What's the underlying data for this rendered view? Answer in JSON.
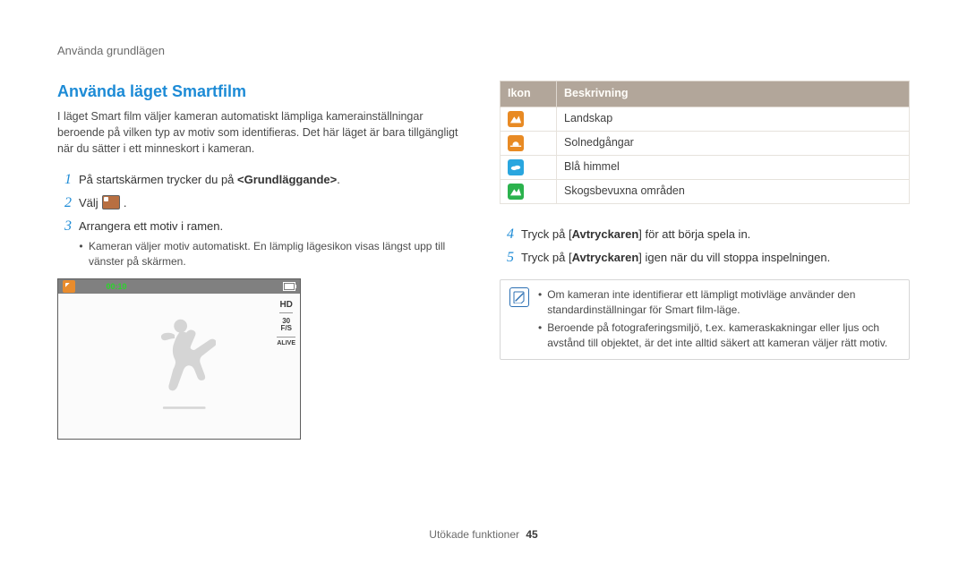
{
  "breadcrumb": "Använda grundlägen",
  "section_title": "Använda läget Smartfilm",
  "intro": "I läget Smart film väljer kameran automatiskt lämpliga kamerainställningar beroende på vilken typ av motiv som identifieras. Det här läget är bara tillgängligt när du sätter i ett minneskort i kameran.",
  "steps_left": [
    {
      "num": "1",
      "pre": "På startskärmen trycker du på ",
      "bold": "<Grundläggande>",
      "post": ".",
      "sub": null
    },
    {
      "num": "2",
      "pre": "Välj ",
      "bold": null,
      "post": ".",
      "icon": "smart-mode-icon",
      "sub": null
    },
    {
      "num": "3",
      "pre": "Arrangera ett motiv i ramen.",
      "bold": null,
      "post": "",
      "sub": [
        "Kameran väljer motiv automatiskt. En lämplig lägesikon visas längst upp till vänster på skärmen."
      ]
    }
  ],
  "steps_right": [
    {
      "num": "4",
      "pre": "Tryck på [",
      "bold": "Avtryckaren",
      "post": "] för att börja spela in."
    },
    {
      "num": "5",
      "pre": "Tryck på [",
      "bold": "Avtryckaren",
      "post": "] igen när du vill stoppa inspelningen."
    }
  ],
  "table": {
    "head_icon": "Ikon",
    "head_desc": "Beskrivning",
    "rows": [
      {
        "icon": "landscape-icon",
        "label": "Landskap"
      },
      {
        "icon": "sunset-icon",
        "label": "Solnedgångar"
      },
      {
        "icon": "bluesky-icon",
        "label": "Blå himmel"
      },
      {
        "icon": "forest-icon",
        "label": "Skogsbevuxna områden"
      }
    ]
  },
  "viewfinder": {
    "timer": "00:10",
    "hd": "HD",
    "fps_top": "30",
    "fps_bot": "F/S",
    "alive": "ALIVE"
  },
  "note": {
    "items": [
      "Om kameran inte identifierar ett lämpligt motivläge använder den standardinställningar för Smart film-läge.",
      "Beroende på fotograferingsmiljö, t.ex. kameraskakningar eller ljus och avstånd till objektet, är det inte alltid säkert att kameran väljer rätt motiv."
    ]
  },
  "footer": {
    "text": "Utökade funktioner",
    "page": "45"
  }
}
